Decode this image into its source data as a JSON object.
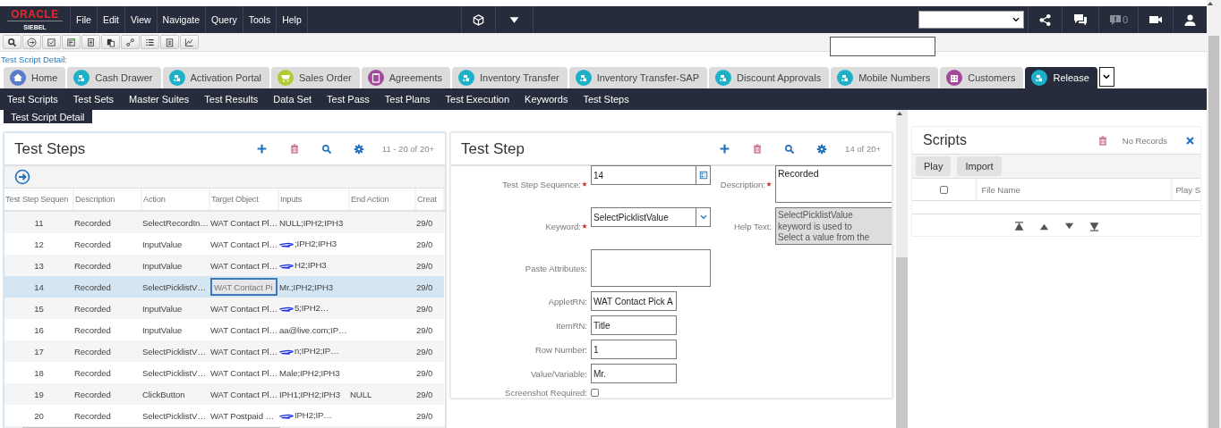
{
  "header": {
    "logo_top": "ORACLE",
    "logo_bottom": "SIEBEL",
    "menu": [
      "File",
      "Edit",
      "View",
      "Navigate",
      "Query",
      "Tools",
      "Help"
    ],
    "alert_count": "0"
  },
  "toolbar": {
    "buttons": [
      {
        "kind": "search"
      },
      {
        "kind": "arrow"
      },
      {
        "kind": "check"
      },
      {
        "kind": "note"
      },
      {
        "kind": "doc"
      },
      {
        "kind": "paste"
      },
      {
        "kind": "link"
      },
      {
        "kind": "list"
      },
      {
        "kind": "clipboard"
      },
      {
        "kind": "chart"
      }
    ]
  },
  "breadcrumb": "Test Script Detail:",
  "tabs": [
    {
      "label": "Home",
      "kind": "home",
      "color": "#5b7bc8",
      "selected": false
    },
    {
      "label": "Cash Drawer",
      "kind": "app",
      "color": "#1cb0c9",
      "selected": false
    },
    {
      "label": "Activation Portal",
      "kind": "app",
      "color": "#1cb0c9",
      "selected": false
    },
    {
      "label": "Sales Order",
      "kind": "cart",
      "color": "#b5c935",
      "selected": false
    },
    {
      "label": "Agreements",
      "kind": "clipboard",
      "color": "#a3479a",
      "selected": false
    },
    {
      "label": "Inventory Transfer",
      "kind": "app",
      "color": "#1cb0c9",
      "selected": false
    },
    {
      "label": "Inventory Transfer-SAP",
      "kind": "app",
      "color": "#1cb0c9",
      "selected": false
    },
    {
      "label": "Discount Approvals",
      "kind": "app",
      "color": "#1cb0c9",
      "selected": false
    },
    {
      "label": "Mobile Numbers",
      "kind": "app",
      "color": "#1cb0c9",
      "selected": false
    },
    {
      "label": "Customers",
      "kind": "building",
      "color": "#a3479a",
      "selected": false
    },
    {
      "label": "Release",
      "kind": "app",
      "color": "#1cb0c9",
      "selected": true
    }
  ],
  "nav": [
    "Test Scripts",
    "Test Sets",
    "Master Suites",
    "Test Results",
    "Data Set",
    "Test Pass",
    "Test Plans",
    "Test Execution",
    "Keywords",
    "Test Steps"
  ],
  "view_button": "Test Script Detail",
  "steps_list": {
    "title": "Test Steps",
    "counter": "11 - 20 of 20+",
    "columns": [
      "Test Step Sequen",
      "Description",
      "Action",
      "Target Object",
      "Inputs",
      "End Action",
      "Creat"
    ],
    "rows": [
      {
        "sequence": "11",
        "description": "Recorded",
        "action": "SelectRecordIn…",
        "target": "WAT Contact Pl…",
        "inputs": "NULL;IPH2;IPH3",
        "scribbled": false,
        "end_action": "",
        "created": "29/0",
        "selected": false
      },
      {
        "sequence": "12",
        "description": "Recorded",
        "action": "InputValue",
        "target": "WAT Contact Pl…",
        "inputs": ";IPH2;IPH3",
        "scribbled": true,
        "end_action": "",
        "created": "29/0",
        "selected": false
      },
      {
        "sequence": "13",
        "description": "Recorded",
        "action": "InputValue",
        "target": "WAT Contact Pl…",
        "inputs": "H2;IPH3",
        "scribbled": true,
        "end_action": "",
        "created": "29/0",
        "selected": false
      },
      {
        "sequence": "14",
        "description": "Recorded",
        "action": "SelectPicklistV…",
        "target": "WAT Contact Pi",
        "inputs": "Mr.;IPH2;IPH3",
        "scribbled": false,
        "end_action": "",
        "created": "29/0",
        "selected": true
      },
      {
        "sequence": "15",
        "description": "Recorded",
        "action": "InputValue",
        "target": "WAT Contact Pl…",
        "inputs": "5;IPH2…",
        "scribbled": true,
        "end_action": "",
        "created": "29/0",
        "selected": false
      },
      {
        "sequence": "16",
        "description": "Recorded",
        "action": "InputValue",
        "target": "WAT Contact Pl…",
        "inputs": "aa@live.com;IP…",
        "scribbled": false,
        "end_action": "",
        "created": "29/0",
        "selected": false
      },
      {
        "sequence": "17",
        "description": "Recorded",
        "action": "SelectPicklistV…",
        "target": "WAT Contact Pl…",
        "inputs": "n;IPH2;IP…",
        "scribbled": true,
        "end_action": "",
        "created": "29/0",
        "selected": false
      },
      {
        "sequence": "18",
        "description": "Recorded",
        "action": "SelectPicklistV…",
        "target": "WAT Contact Pl…",
        "inputs": "Male;IPH2;IPH3",
        "scribbled": false,
        "end_action": "",
        "created": "29/0",
        "selected": false
      },
      {
        "sequence": "19",
        "description": "Recorded",
        "action": "ClickButton",
        "target": "WAT Contact Pl…",
        "inputs": "IPH1;IPH2;IPH3",
        "scribbled": false,
        "end_action": "NULL",
        "created": "29/0",
        "selected": false
      },
      {
        "sequence": "20",
        "description": "Recorded",
        "action": "SelectPicklistV…",
        "target": "WAT Postpaid …",
        "inputs": "IPH2;IP…",
        "scribbled": true,
        "end_action": "",
        "created": "29/0",
        "selected": false
      }
    ]
  },
  "step_form": {
    "title": "Test Step",
    "counter": "14 of 20+",
    "main_fields": [
      {
        "label": "Test Step Sequence:",
        "required": true,
        "kind": "picker",
        "value": "14"
      },
      {
        "label": "Keyword:",
        "required": true,
        "kind": "select",
        "value": "SelectPicklistValue"
      },
      {
        "label": "Paste Attributes:",
        "required": false,
        "kind": "textarea"
      },
      {
        "label": "AppletRN:",
        "required": false,
        "kind": "text",
        "value": "WAT Contact Pick A"
      },
      {
        "label": "ItemRN:",
        "required": false,
        "kind": "text",
        "value": "Title"
      },
      {
        "label": "Row Number:",
        "required": false,
        "kind": "text",
        "value": "1"
      },
      {
        "label": "Value/Variable:",
        "required": false,
        "kind": "text",
        "value": "Mr."
      },
      {
        "label": "Screenshot Required:",
        "required": false,
        "kind": "checkbox",
        "checked": false
      }
    ],
    "side_fields": [
      {
        "label": "Description:",
        "required": true,
        "kind": "textarea",
        "value": "Recorded"
      },
      {
        "label": "Help Text:",
        "required": false,
        "kind": "readonly",
        "value": "SelectPicklistValue keyword is used to Select a value from the"
      }
    ]
  },
  "scripts": {
    "title": "Scripts",
    "status": "No Records",
    "buttons": [
      "Play",
      "Import"
    ],
    "columns": [
      "File Name",
      "Play S"
    ],
    "select_all_checked": false
  }
}
